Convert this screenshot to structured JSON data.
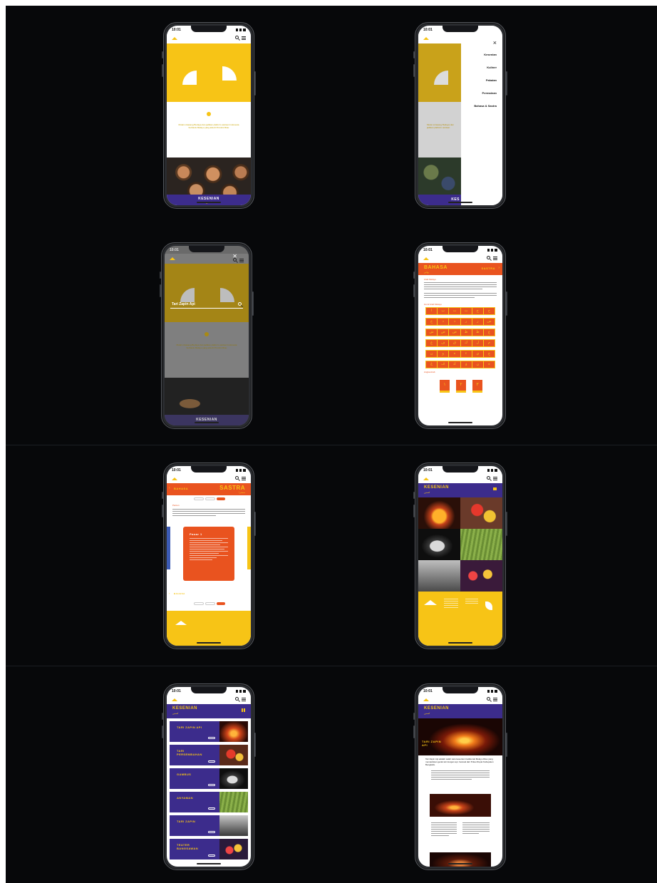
{
  "status": {
    "time": "10:01"
  },
  "s1": {
    "intro": "Mulai Lintasang Budaya dan jadikan platform warisan Indonesia berbasis Melayu yang ada di Provinsi Riau",
    "footer_title": "KESENIAN",
    "footer_sub": "كسنين"
  },
  "s2": {
    "close": "×",
    "menu": [
      "Kesenian",
      "Kuliner",
      "Pakaian",
      "Permainan",
      "Bahasa & Sastra"
    ],
    "footer_title": "KES"
  },
  "s3": {
    "close": "✕",
    "search_value": "Tari Zapin Api",
    "footer_title": "KESENIAN"
  },
  "s4": {
    "title": "BAHASA",
    "title_sub": "بهاس",
    "side": "SASTRA",
    "section1": "Arab Melayu",
    "section2": "Huruf Arab Melayu",
    "section3": "Angka Arab",
    "letters": [
      "ا",
      "ب",
      "ت",
      "ث",
      "ج",
      "ح",
      "خ",
      "د",
      "ذ",
      "ر",
      "ز",
      "س",
      "ش",
      "ص",
      "ض",
      "ط",
      "ظ",
      "ع",
      "غ",
      "ف",
      "ق",
      "ك",
      "ل",
      "م",
      "ن",
      "و",
      "ه",
      "ء",
      "ي",
      "چ",
      "ڠ",
      "ڤ",
      "ݢ",
      "ۏ",
      "ڽ",
      "ة"
    ],
    "numbers": [
      "١",
      "٢",
      "٣"
    ]
  },
  "s5": {
    "back": "BAHASA",
    "title": "SASTRA",
    "title_sub": "سسترا",
    "section": "Pantun",
    "card_title": "Pasar 1",
    "back2": "BAHASA"
  },
  "s6": {
    "title": "KESENIAN",
    "title_sub": "كسنين"
  },
  "s7": {
    "title": "KESENIAN",
    "title_sub": "كسنين",
    "items": [
      "TARI ZAPIN API",
      "TARI PERSEMBAHAN",
      "GAMBUS",
      "ANYAMAN",
      "TARI ZAPIN",
      "TEATER BANGSAWAN"
    ]
  },
  "s8": {
    "title": "KESENIAN",
    "title_sub": "كسنين",
    "hero_label": "TARI ZAPIN API",
    "lead": "Tari Zapin Api adalah salah satu kesenian tradisional Melayu Riau yang memadukan gerak tari dengan api, berasal dari Pulau Rupat Kabupaten Bengkalis."
  },
  "colors": {
    "yellow": "#f7c416",
    "purple": "#3c2c8c",
    "orange": "#e9531f",
    "board": "#07080a"
  }
}
